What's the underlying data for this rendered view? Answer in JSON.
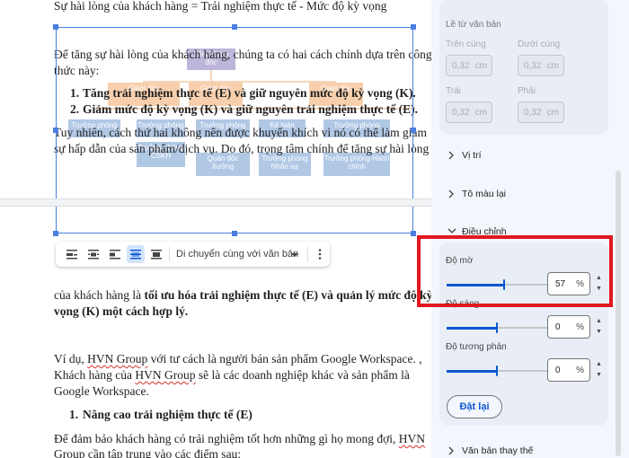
{
  "document": {
    "top_line": "Sự hài lòng của khách hàng = Trải nghiệm thực tế - Mức độ kỳ vọng",
    "para1_line1": "Để tăng sự hài lòng của khách hàng, chúng ta có hai cách chính dựa trên công",
    "para1_line2": "thức này:",
    "list_item1": "Tăng trải nghiệm thực tế (E) và giữ nguyên mức độ kỳ vọng (K).",
    "list_item2": "Giảm mức độ kỳ vọng (K) và giữ nguyên trải nghiệm thực tế (E).",
    "list_num1": "1.",
    "list_num2": "2.",
    "para2_line1": "Tuy nhiên, cách thứ hai không nên được khuyến khích vì nó có thể làm giảm",
    "para2_line2": "sự hấp dẫn của sản phẩm/dịch vụ. Do đó, trọng tâm chính để tăng sự hài lòng",
    "para3_line1_a": "của khách hàng là ",
    "para3_line1_b": "tối ưu hóa trải nghiệm thực tế (E) và quản lý mức độ kỳ",
    "para3_line2": "vọng (K) một cách hợp lý.",
    "para4_line1_a": "Ví dụ, ",
    "para4_hvn": "HVN Group",
    "para4_line1_b": " với tư cách là người bán sản phẩm Google Workspace. ,",
    "para4_line2_a": "Khách hàng của ",
    "para4_line2_b": " sẽ là các doanh nghiệp khác và sản phẩm là",
    "para4_line3": "Google Workspace.",
    "heading_num": "1.",
    "heading": "Nâng cao trải nghiệm thực tế (E)",
    "para5_line1_a": "Để đảm bảo khách hàng có trải nghiệm tốt hơn những gì họ mong đợi, ",
    "para5_hvn": "HVN",
    "para5_line2_a": "Group",
    "para5_line2_b": " cần tập trung vào các điểm sau:"
  },
  "org_chart": {
    "top": "Tổng Giám đốc",
    "left_dir": "Giám đốc",
    "mid_dir": "Giám đốc",
    "right_dir": "Giám đốc",
    "b1": "Trưởng phòng",
    "b2": "Trưởng phòng",
    "b3": "Trưởng phòng CSKH",
    "b4": "Trưởng phòng",
    "b5": "Quản đốc Xưởng",
    "b6": "Kế toán",
    "b7": "Trưởng phòng Nhân sự",
    "b8": "Trưởng phòng",
    "b9": "Trưởng phòng Hành chính"
  },
  "image_toolbar": {
    "wrap_mode": "Di chuyển cùng với văn bản"
  },
  "panel": {
    "margins_title": "Lề từ văn bản",
    "top_label": "Trên cùng",
    "bottom_label": "Dưới cùng",
    "left_label": "Trái",
    "right_label": "Phải",
    "margin_value": "0,32",
    "margin_unit": "cm",
    "position": "Vị trí",
    "recolor": "Tô màu lại",
    "adjust": "Điều chỉnh",
    "opacity_label": "Độ mờ",
    "opacity_value": "57",
    "brightness_label": "Độ sáng",
    "brightness_value": "0",
    "contrast_label": "Độ tương phản",
    "contrast_value": "0",
    "percent": "%",
    "reset_button": "Đặt lại",
    "alt_text": "Văn bản thay thế",
    "opacity_level": 0.57,
    "brightness_level": 0,
    "contrast_level": 0
  },
  "colors": {
    "accent": "#0b57d0",
    "highlight_box": "#e2181f",
    "selection": "#4a7fe0"
  }
}
